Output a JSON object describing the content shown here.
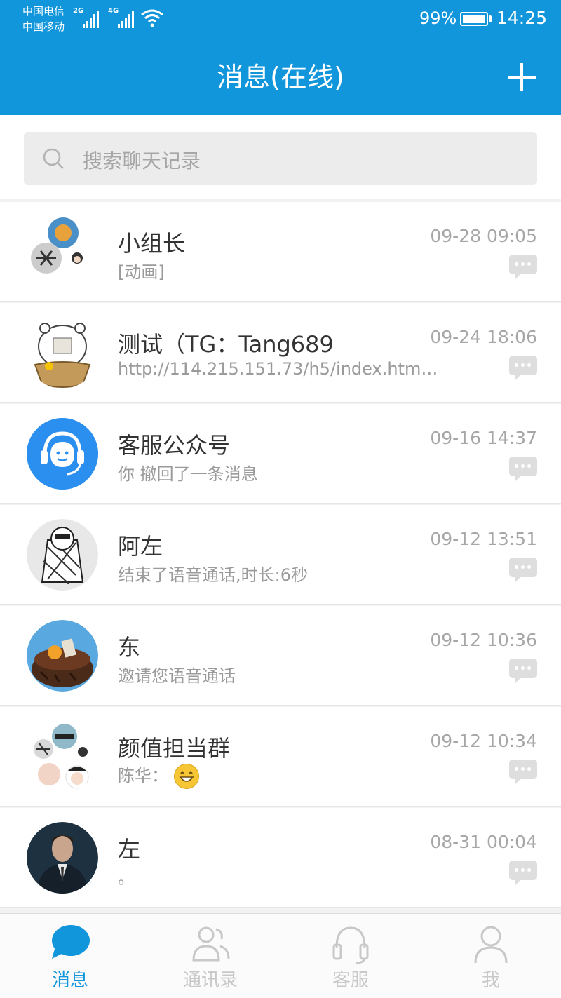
{
  "status_bar": {
    "carrier1": "中国电信",
    "carrier2": "中国移动",
    "signal1": "2G",
    "signal2": "4G",
    "battery": "99%",
    "battery_level": 0.99,
    "time": "14:25"
  },
  "header": {
    "title": "消息(在线)",
    "add_icon": "plus-icon"
  },
  "search": {
    "placeholder": "搜索聊天记录"
  },
  "conversations": [
    {
      "name": "小组长",
      "preview": "[动画]",
      "time": "09-28 09:05",
      "avatar": "group-avatar"
    },
    {
      "name": "测试（TG：Tang689",
      "preview": "http://114.215.151.73/h5/index.html...",
      "time": "09-24 18:06",
      "avatar": "bear-avatar"
    },
    {
      "name": "客服公众号",
      "preview": "你 撤回了一条消息",
      "time": "09-16 14:37",
      "avatar": "headset-avatar"
    },
    {
      "name": "阿左",
      "preview": "结束了语音通话,时长:6秒",
      "time": "09-12 13:51",
      "avatar": "sketch-avatar"
    },
    {
      "name": "东",
      "preview": "邀请您语音通话",
      "time": "09-12 10:36",
      "avatar": "cake-avatar"
    },
    {
      "name": "颜值担当群",
      "preview": "陈华：",
      "time": "09-12 10:34",
      "avatar": "group-avatar"
    },
    {
      "name": "左",
      "preview": "。",
      "time": "08-31 00:04",
      "avatar": "photo-avatar"
    }
  ],
  "tabs": [
    {
      "label": "消息",
      "icon": "chat-bubble-icon",
      "active": true
    },
    {
      "label": "通讯录",
      "icon": "contacts-icon",
      "active": false
    },
    {
      "label": "客服",
      "icon": "headset-icon",
      "active": false
    },
    {
      "label": "我",
      "icon": "person-icon",
      "active": false
    }
  ],
  "colors": {
    "accent": "#1196db",
    "inactive": "#c8c8c8"
  }
}
